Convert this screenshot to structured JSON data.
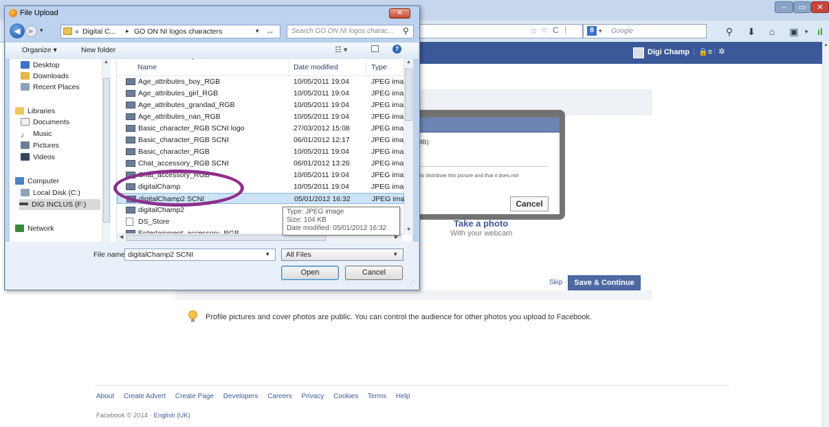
{
  "browser": {
    "search_engine": "Google",
    "window_controls": [
      "minimize",
      "maximize",
      "close"
    ]
  },
  "facebook": {
    "user_name": "Digi Champ",
    "modal_text_size": "MB):",
    "modal_rights_text": "t to distribute this picture and that it does not",
    "modal_cancel": "Cancel",
    "take_photo_title": "Take a photo",
    "take_photo_subtitle": "With your webcam",
    "skip_label": "Skip ·",
    "save_continue_label": "Save & Continue",
    "privacy_note": "Profile pictures and cover photos are public. You can control the audience for other photos you upload to Facebook.",
    "footer_links": [
      "About",
      "Create Advert",
      "Create Page",
      "Developers",
      "Careers",
      "Privacy",
      "Cookies",
      "Terms",
      "Help"
    ],
    "copyright": "Facebook © 2014 · ",
    "language": "English (UK)",
    "colors": {
      "brand_blue": "#3b5998",
      "button_blue": "#4e69a2"
    }
  },
  "dialog": {
    "title": "File Upload",
    "breadcrumb": [
      "«",
      "Digital C...",
      "▸",
      "GO ON NI logos characters"
    ],
    "search_placeholder": "Search GO ON NI logos charac...",
    "toolbar": {
      "organize": "Organize ▾",
      "new_folder": "New folder"
    },
    "nav": {
      "desktop": "Desktop",
      "downloads": "Downloads",
      "recent_places": "Recent Places",
      "libraries": "Libraries",
      "documents": "Documents",
      "music": "Music",
      "pictures": "Pictures",
      "videos": "Videos",
      "computer": "Computer",
      "local_disk": "Local Disk (C:)",
      "dig_inclus": "DIG INCLUS (F:)",
      "network": "Network"
    },
    "columns": {
      "name": "Name",
      "date_modified": "Date modified",
      "type": "Type"
    },
    "files": [
      {
        "name": "Age_attributes_boy_RGB",
        "date": "10/05/2011 19:04",
        "type": "JPEG ima"
      },
      {
        "name": "Age_attributes_girl_RGB",
        "date": "10/05/2011 19:04",
        "type": "JPEG ima"
      },
      {
        "name": "Age_attributes_grandad_RGB",
        "date": "10/05/2011 19:04",
        "type": "JPEG ima"
      },
      {
        "name": "Age_attributes_nan_RGB",
        "date": "10/05/2011 19:04",
        "type": "JPEG ima"
      },
      {
        "name": "Basic_character_RGB SCNI logo",
        "date": "27/03/2012 15:08",
        "type": "JPEG ima"
      },
      {
        "name": "Basic_character_RGB SCNI",
        "date": "06/01/2012 12:17",
        "type": "JPEG ima"
      },
      {
        "name": "Basic_character_RGB",
        "date": "10/05/2011 19:04",
        "type": "JPEG ima"
      },
      {
        "name": "Chat_accessory_RGB SCNI",
        "date": "06/01/2012 13:26",
        "type": "JPEG ima"
      },
      {
        "name": "Chat_accessory_RGB",
        "date": "10/05/2011 19:04",
        "type": "JPEG ima"
      },
      {
        "name": "digitalChamp",
        "date": "10/05/2011 19:04",
        "type": "JPEG ima"
      },
      {
        "name": "digitalChamp2 SCNI",
        "date": "05/01/2012 16:32",
        "type": "JPEG ima"
      },
      {
        "name": "digitalChamp2",
        "date": "",
        "type": ""
      },
      {
        "name": "DS_Store",
        "date": "",
        "type": ""
      },
      {
        "name": "Entertainment_accessory_RGB",
        "date": "",
        "type": ""
      }
    ],
    "tooltip": {
      "type": "Type: JPEG image",
      "size": "Size: 104 KB",
      "date": "Date modified: 05/01/2012 16:32"
    },
    "file_name_label": "File name:",
    "file_name_value": "digitalChamp2 SCNI",
    "filter_value": "All Files",
    "open_button": "Open",
    "cancel_button": "Cancel"
  }
}
